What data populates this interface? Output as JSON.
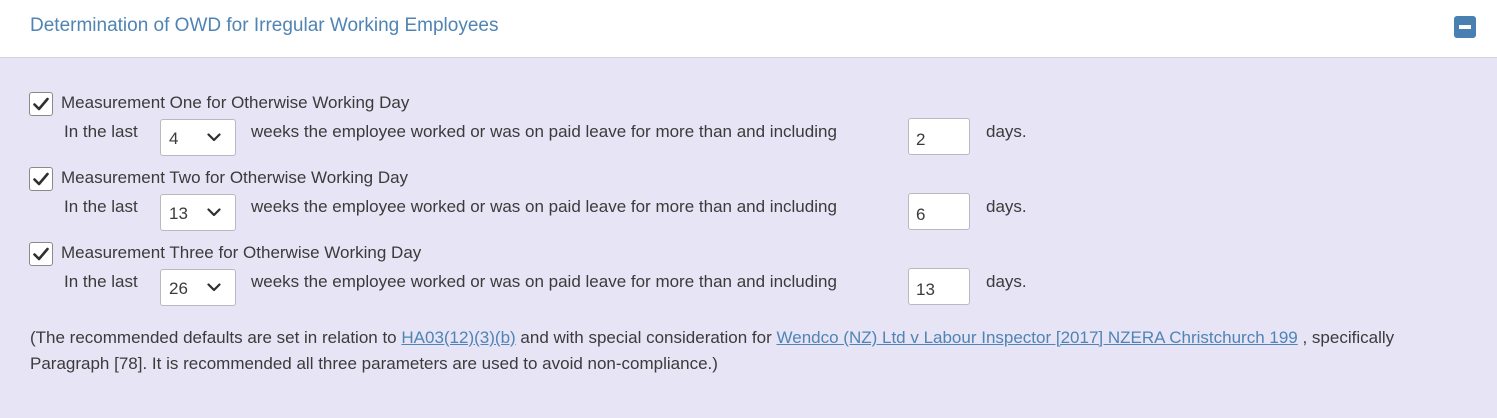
{
  "panel": {
    "title": "Determination of OWD for Irregular Working Employees",
    "collapse_icon": "minus-square-icon"
  },
  "measurements": [
    {
      "checked": true,
      "title": "Measurement One for Otherwise Working Day",
      "prefix": "In the last",
      "weeks": "4",
      "middle": "weeks the employee worked or was on paid leave for more than and including",
      "days": "2",
      "suffix": "days."
    },
    {
      "checked": true,
      "title": "Measurement Two for Otherwise Working Day",
      "prefix": "In the last",
      "weeks": "13",
      "middle": "weeks the employee worked or was on paid leave for more than and including",
      "days": "6",
      "suffix": "days."
    },
    {
      "checked": true,
      "title": "Measurement Three for Otherwise Working Day",
      "prefix": "In the last",
      "weeks": "26",
      "middle": "weeks the employee worked or was on paid leave for more than and including",
      "days": "13",
      "suffix": "days."
    }
  ],
  "note": {
    "part1": "(The recommended defaults are set in relation to ",
    "link1": "HA03(12)(3)(b)",
    "part2": " and with special consideration for ",
    "link2": "Wendco (NZ) Ltd v Labour Inspector [2017] NZERA Christchurch 199",
    "part3": " , specifically Paragraph [78]. It is recommended all three parameters are used to avoid non-compliance.)"
  },
  "colors": {
    "accent": "#4f84b4",
    "body_background": "#e6e4f5",
    "header_background": "#ffffff"
  }
}
